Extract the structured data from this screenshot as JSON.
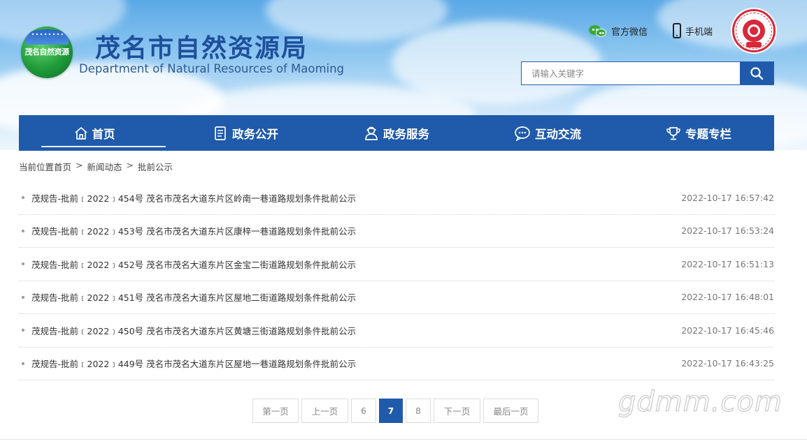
{
  "header": {
    "logo_text": "茂名自然资源",
    "title": "茂名市自然资源局",
    "subtitle": "Department of Natural Resources of Maoming",
    "wechat_label": "官方微信",
    "mobile_label": "手机端"
  },
  "search": {
    "placeholder": "请输入关键字",
    "value": ""
  },
  "nav": {
    "items": [
      {
        "label": "首页",
        "icon": "home-icon",
        "active": true
      },
      {
        "label": "政务公开",
        "icon": "document-icon",
        "active": false
      },
      {
        "label": "政务服务",
        "icon": "service-person-icon",
        "active": false
      },
      {
        "label": "互动交流",
        "icon": "chat-bubble-icon",
        "active": false
      },
      {
        "label": "专题专栏",
        "icon": "trophy-icon",
        "active": false
      }
    ]
  },
  "breadcrumb": {
    "prefix": "当前位置",
    "items": [
      "首页",
      "新闻动态",
      "批前公示"
    ],
    "separator": ">"
  },
  "list": [
    {
      "title": "茂规告-批前﹝2022﹞454号 茂名市茂名大道东片区岭南一巷道路规划条件批前公示",
      "date": "2022-10-17 16:57:42"
    },
    {
      "title": "茂规告-批前﹝2022﹞453号 茂名市茂名大道东片区康梓一巷道路规划条件批前公示",
      "date": "2022-10-17 16:53:24"
    },
    {
      "title": "茂规告-批前﹝2022﹞452号 茂名市茂名大道东片区金宝二街道路规划条件批前公示",
      "date": "2022-10-17 16:51:13"
    },
    {
      "title": "茂规告-批前﹝2022﹞451号 茂名市茂名大道东片区屋地二街道路规划条件批前公示",
      "date": "2022-10-17 16:48:01"
    },
    {
      "title": "茂规告-批前﹝2022﹞450号 茂名市茂名大道东片区黄塘三街道路规划条件批前公示",
      "date": "2022-10-17 16:45:46"
    },
    {
      "title": "茂规告-批前﹝2022﹞449号 茂名市茂名大道东片区屋地一巷道路规划条件批前公示",
      "date": "2022-10-17 16:43:25"
    }
  ],
  "pager": {
    "first": "第一页",
    "prev": "上一页",
    "pages": [
      "6",
      "7",
      "8"
    ],
    "current": "7",
    "next": "下一页",
    "last": "最后一页"
  },
  "watermark": "gdmm.com",
  "colors": {
    "primary": "#1f5aab",
    "title": "#1e4f9c",
    "seal": "#d8283a"
  }
}
